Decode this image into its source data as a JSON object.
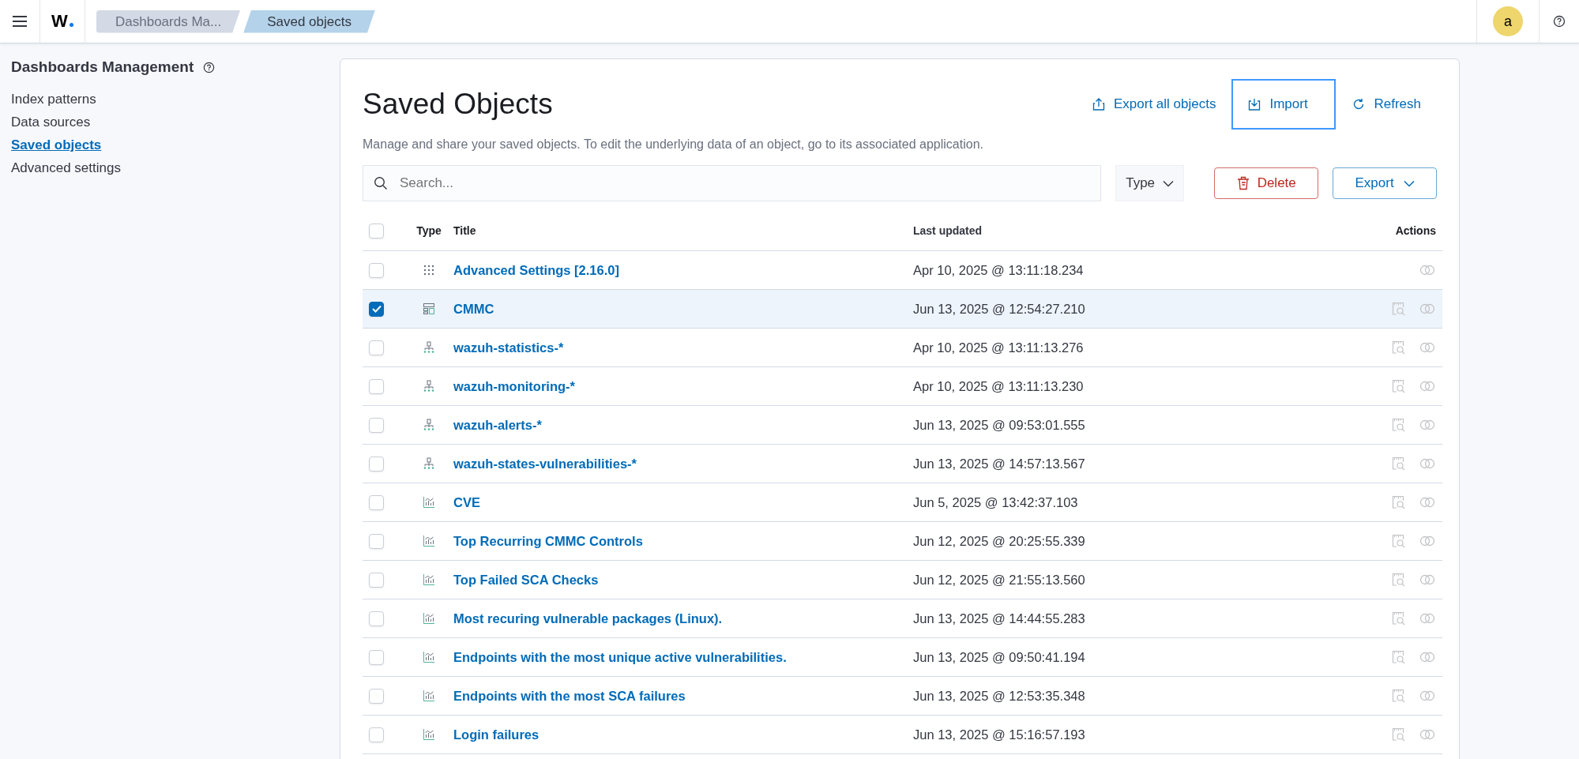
{
  "header": {
    "logo": "W",
    "breadcrumbs": [
      {
        "label": "Dashboards Ma...",
        "selected": false
      },
      {
        "label": "Saved objects",
        "selected": true
      }
    ],
    "avatar": "a"
  },
  "sidebar": {
    "title": "Dashboards Management",
    "items": [
      {
        "label": "Index patterns",
        "selected": false
      },
      {
        "label": "Data sources",
        "selected": false
      },
      {
        "label": "Saved objects",
        "selected": true
      },
      {
        "label": "Advanced settings",
        "selected": false
      }
    ]
  },
  "page": {
    "title": "Saved Objects",
    "actions": [
      {
        "label": "Export all objects",
        "kind": "export",
        "focused": false
      },
      {
        "label": "Import",
        "kind": "import",
        "focused": true
      },
      {
        "label": "Refresh",
        "kind": "refresh",
        "focused": false
      }
    ],
    "description": "Manage and share your saved objects. To edit the underlying data of an object, go to its associated application."
  },
  "toolbar": {
    "search": {
      "placeholder": "Search..."
    },
    "type_filter": "Type",
    "delete": "Delete",
    "export": "Export"
  },
  "table": {
    "columns": [
      "Type",
      "Title",
      "Last updated",
      "Actions"
    ],
    "all_checked": false,
    "rows": [
      {
        "kind": "settings",
        "title": "Advanced Settings [2.16.0]",
        "updated": "Apr 10, 2025 @ 13:11:18.234",
        "selected": false
      },
      {
        "kind": "dashboard",
        "title": "CMMC",
        "updated": "Jun 13, 2025 @ 12:54:27.210",
        "selected": true
      },
      {
        "kind": "index-pattern",
        "title": "wazuh-statistics-*",
        "updated": "Apr 10, 2025 @ 13:11:13.276",
        "selected": false
      },
      {
        "kind": "index-pattern",
        "title": "wazuh-monitoring-*",
        "updated": "Apr 10, 2025 @ 13:11:13.230",
        "selected": false
      },
      {
        "kind": "index-pattern",
        "title": "wazuh-alerts-*",
        "updated": "Jun 13, 2025 @ 09:53:01.555",
        "selected": false
      },
      {
        "kind": "index-pattern",
        "title": "wazuh-states-vulnerabilities-*",
        "updated": "Jun 13, 2025 @ 14:57:13.567",
        "selected": false
      },
      {
        "kind": "visualization",
        "title": "CVE",
        "updated": "Jun 5, 2025 @ 13:42:37.103",
        "selected": false
      },
      {
        "kind": "visualization",
        "title": "Top Recurring CMMC Controls",
        "updated": "Jun 12, 2025 @ 20:25:55.339",
        "selected": false
      },
      {
        "kind": "visualization",
        "title": "Top Failed SCA Checks",
        "updated": "Jun 12, 2025 @ 21:55:13.560",
        "selected": false
      },
      {
        "kind": "visualization",
        "title": "Most recuring vulnerable packages (Linux).",
        "updated": "Jun 13, 2025 @ 14:44:55.283",
        "selected": false
      },
      {
        "kind": "visualization",
        "title": "Endpoints with the most unique active vulnerabilities.",
        "updated": "Jun 13, 2025 @ 09:50:41.194",
        "selected": false
      },
      {
        "kind": "visualization",
        "title": "Endpoints with the most SCA failures",
        "updated": "Jun 13, 2025 @ 12:53:35.348",
        "selected": false
      },
      {
        "kind": "visualization",
        "title": "Login failures",
        "updated": "Jun 13, 2025 @ 15:16:57.193",
        "selected": false
      }
    ]
  }
}
